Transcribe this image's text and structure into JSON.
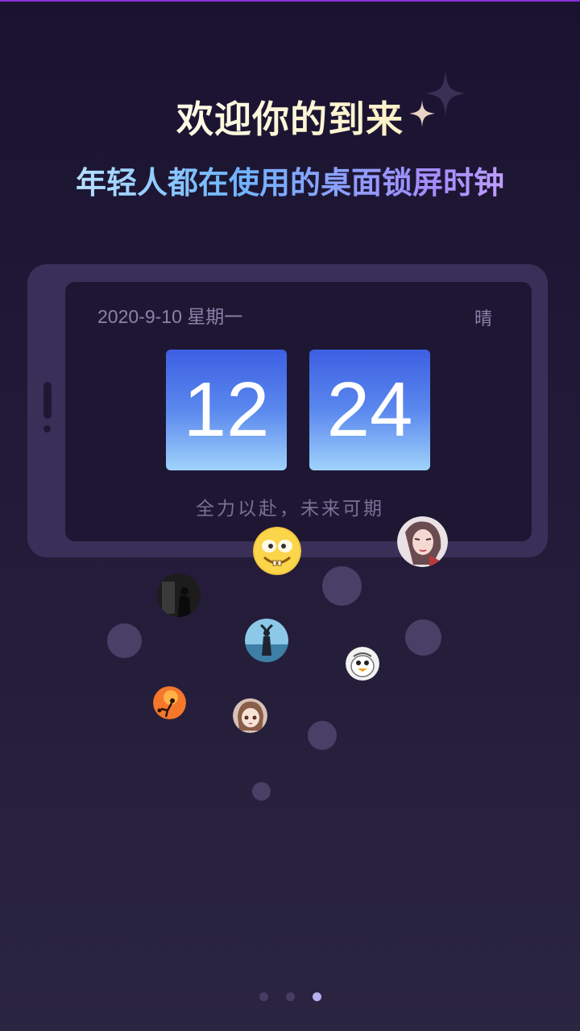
{
  "welcome": {
    "title": "欢迎你的到来",
    "subtitle": "年轻人都在使用的桌面锁屏时钟"
  },
  "clock": {
    "date": "2020-9-10 星期一",
    "weather": "晴",
    "hours": "12",
    "minutes": "24",
    "motto": "全力以赴，未来可期"
  },
  "avatars": [
    {
      "name": "yellow-face-avatar",
      "icon": "yellow-cartoon-face"
    },
    {
      "name": "girl-avatar",
      "icon": "girl-photo"
    },
    {
      "name": "dark-silhouette-avatar",
      "icon": "dark-silhouette"
    },
    {
      "name": "beach-silhouette-avatar",
      "icon": "beach-silhouette"
    },
    {
      "name": "cartoon-bird-avatar",
      "icon": "cartoon-bird"
    },
    {
      "name": "sunset-kick-avatar",
      "icon": "sunset-silhouette"
    },
    {
      "name": "anime-girl-avatar",
      "icon": "anime-girl"
    }
  ],
  "pager": {
    "pages": 3,
    "active_index": 2
  },
  "colors": {
    "background_top": "#1a1330",
    "background_bottom": "#2a2540",
    "accent_top_line": "#8a2fd6",
    "flip_top": "#3d5fe2",
    "flip_bottom": "#9fd2fb"
  }
}
